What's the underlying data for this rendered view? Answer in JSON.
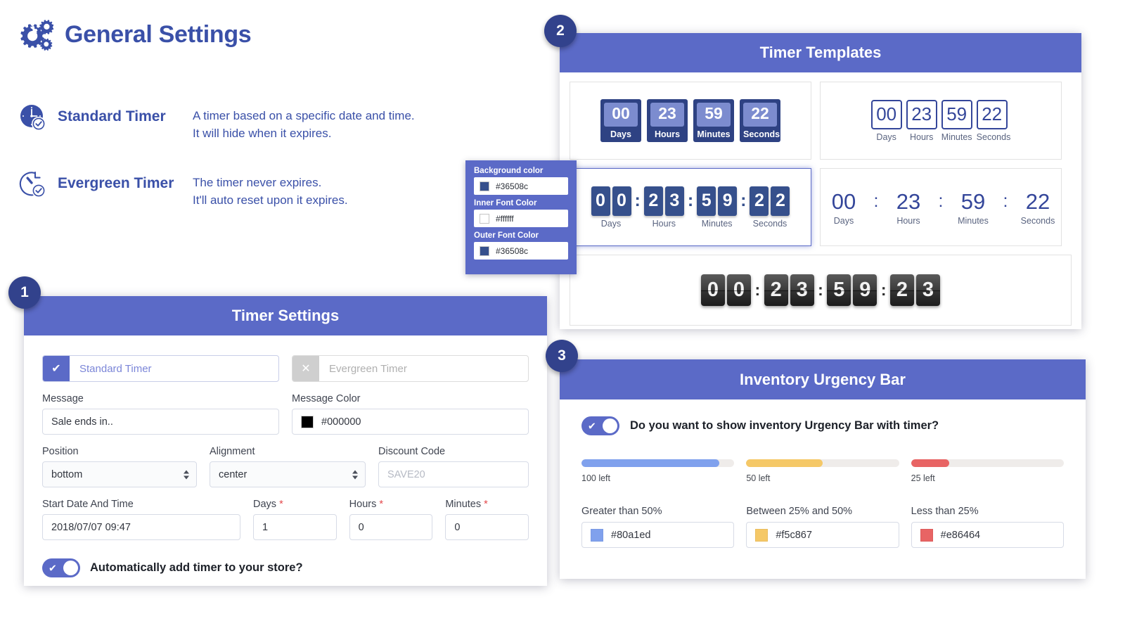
{
  "header": {
    "title": "General Settings",
    "gear_icon": "gears-icon"
  },
  "timer_types": [
    {
      "icon": "clock-check-filled-icon",
      "name": "Standard Timer",
      "desc_line1": "A timer based on a specific date and time.",
      "desc_line2": "It will hide when it expires."
    },
    {
      "icon": "clock-reset-check-outline-icon",
      "name": "Evergreen Timer",
      "desc_line1": "The timer never expires.",
      "desc_line2": "It'll auto reset upon it expires."
    }
  ],
  "panel1": {
    "badge": "1",
    "title": "Timer Settings",
    "type_standard": {
      "label": "Standard Timer",
      "checked": true,
      "mark": "✔"
    },
    "type_evergreen": {
      "label": "Evergreen Timer",
      "checked": false,
      "mark": "✕"
    },
    "message": {
      "label": "Message",
      "value": "Sale ends in.."
    },
    "message_color": {
      "label": "Message Color",
      "value": "#000000",
      "swatch": "#000000"
    },
    "position": {
      "label": "Position",
      "value": "bottom"
    },
    "alignment": {
      "label": "Alignment",
      "value": "center"
    },
    "discount_code": {
      "label": "Discount Code",
      "placeholder": "SAVE20",
      "value": ""
    },
    "start_datetime": {
      "label": "Start Date And Time",
      "value": "2018/07/07 09:47"
    },
    "days": {
      "label": "Days",
      "required": "*",
      "value": "1"
    },
    "hours": {
      "label": "Hours",
      "required": "*",
      "value": "0"
    },
    "minutes": {
      "label": "Minutes",
      "required": "*",
      "value": "0"
    },
    "auto_add": {
      "label": "Automatically add timer to your store?",
      "on": true
    }
  },
  "color_popup": {
    "background_color": {
      "label": "Background color",
      "value": "#36508c",
      "swatch": "#36508c"
    },
    "inner_font_color": {
      "label": "Inner Font Color",
      "value": "#ffffff",
      "swatch": "#ffffff"
    },
    "outer_font_color": {
      "label": "Outer Font Color",
      "value": "#36508c",
      "swatch": "#36508c"
    }
  },
  "panel2": {
    "badge": "2",
    "title": "Timer Templates",
    "captions": [
      "Days",
      "Hours",
      "Minutes",
      "Seconds"
    ],
    "templates": [
      {
        "style": "solid-blocks",
        "selected": false,
        "values": [
          "00",
          "23",
          "59",
          "22"
        ]
      },
      {
        "style": "outlined-boxes",
        "selected": false,
        "values": [
          "00",
          "23",
          "59",
          "22"
        ]
      },
      {
        "style": "split-digits",
        "selected": true,
        "values": [
          "00",
          "23",
          "59",
          "22"
        ],
        "separator": ":"
      },
      {
        "style": "plain-colon",
        "selected": false,
        "values": [
          "00",
          "23",
          "59",
          "22"
        ],
        "separator": ":"
      },
      {
        "style": "flip-clock",
        "selected": false,
        "values": [
          "00",
          "23",
          "59",
          "23"
        ],
        "separator": ":"
      }
    ]
  },
  "panel3": {
    "badge": "3",
    "title": "Inventory Urgency Bar",
    "toggle": {
      "label": "Do you want to show inventory Urgency Bar with timer?",
      "on": true
    },
    "bars": [
      {
        "caption": "100 left",
        "fill_percent": 90,
        "color": "#80a1ed"
      },
      {
        "caption": "50 left",
        "fill_percent": 50,
        "color": "#f5c867"
      },
      {
        "caption": "25 left",
        "fill_percent": 25,
        "color": "#e86464"
      }
    ],
    "color_fields": [
      {
        "label": "Greater than 50%",
        "value": "#80a1ed",
        "swatch": "#80a1ed"
      },
      {
        "label": "Between 25% and 50%",
        "value": "#f5c867",
        "swatch": "#f5c867"
      },
      {
        "label": "Less than 25%",
        "value": "#e86464",
        "swatch": "#e86464"
      }
    ]
  },
  "theme": {
    "accent": "#5b6ac7",
    "navy": "#32428c",
    "title_blue": "#3a50a8"
  }
}
